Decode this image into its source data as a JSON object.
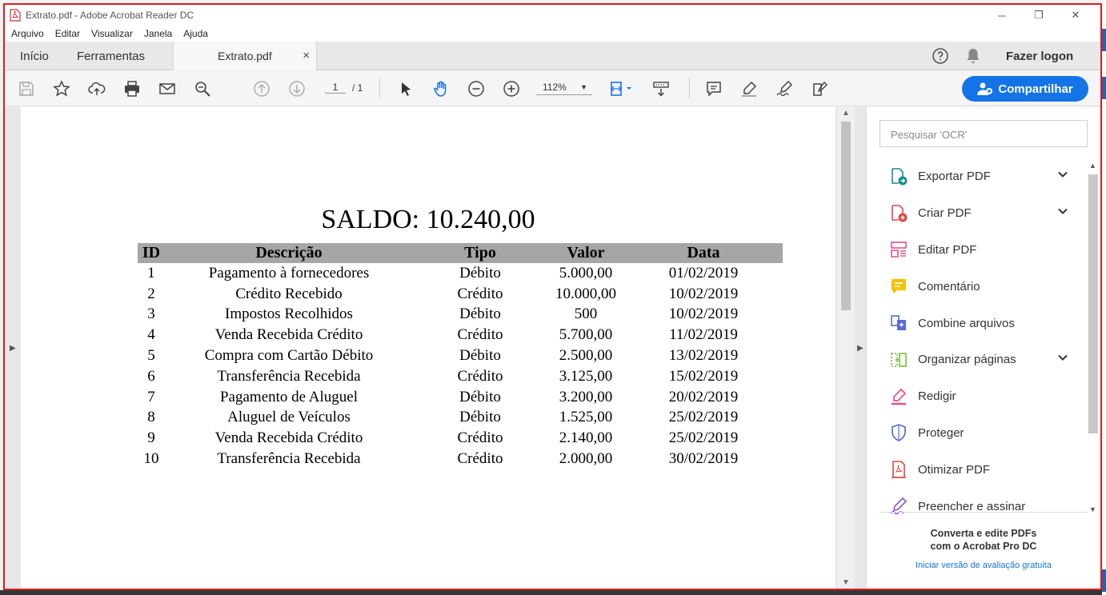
{
  "window": {
    "title": "Extrato.pdf - Adobe Acrobat Reader DC",
    "minimize": "─",
    "restore": "❐",
    "close": "✕"
  },
  "menu": [
    "Arquivo",
    "Editar",
    "Visualizar",
    "Janela",
    "Ajuda"
  ],
  "tabs": {
    "home": "Início",
    "tools": "Ferramentas",
    "document": "Extrato.pdf",
    "close": "×",
    "login": "Fazer logon"
  },
  "toolbar": {
    "page_current": "1",
    "page_total": "/ 1",
    "zoom": "112%",
    "share": "Compartilhar"
  },
  "document": {
    "balance": "SALDO: 10.240,00",
    "columns": [
      "ID",
      "Descrição",
      "Tipo",
      "Valor",
      "Data"
    ],
    "rows": [
      [
        "1",
        "Pagamento à fornecedores",
        "Débito",
        "5.000,00",
        "01/02/2019"
      ],
      [
        "2",
        "Crédito Recebido",
        "Crédito",
        "10.000,00",
        "10/02/2019"
      ],
      [
        "3",
        "Impostos Recolhidos",
        "Débito",
        "500",
        "10/02/2019"
      ],
      [
        "4",
        "Venda Recebida Crédito",
        "Crédito",
        "5.700,00",
        "11/02/2019"
      ],
      [
        "5",
        "Compra com Cartão Débito",
        "Débito",
        "2.500,00",
        "13/02/2019"
      ],
      [
        "6",
        "Transferência Recebida",
        "Crédito",
        "3.125,00",
        "15/02/2019"
      ],
      [
        "7",
        "Pagamento de Aluguel",
        "Débito",
        "3.200,00",
        "20/02/2019"
      ],
      [
        "8",
        "Aluguel de Veículos",
        "Débito",
        "1.525,00",
        "25/02/2019"
      ],
      [
        "9",
        "Venda Recebida Crédito",
        "Crédito",
        "2.140,00",
        "25/02/2019"
      ],
      [
        "10",
        "Transferência Recebida",
        "Crédito",
        "2.000,00",
        "30/02/2019"
      ]
    ]
  },
  "right_panel": {
    "search_placeholder": "Pesquisar 'OCR'",
    "tools": [
      {
        "label": "Exportar PDF",
        "icon": "export-pdf-icon",
        "expandable": true
      },
      {
        "label": "Criar PDF",
        "icon": "create-pdf-icon",
        "expandable": true
      },
      {
        "label": "Editar PDF",
        "icon": "edit-pdf-icon",
        "expandable": false
      },
      {
        "label": "Comentário",
        "icon": "comment-icon",
        "expandable": false
      },
      {
        "label": "Combine arquivos",
        "icon": "combine-files-icon",
        "expandable": false
      },
      {
        "label": "Organizar páginas",
        "icon": "organize-pages-icon",
        "expandable": true
      },
      {
        "label": "Redigir",
        "icon": "redact-icon",
        "expandable": false
      },
      {
        "label": "Proteger",
        "icon": "protect-icon",
        "expandable": false
      },
      {
        "label": "Otimizar PDF",
        "icon": "optimize-pdf-icon",
        "expandable": false
      },
      {
        "label": "Preencher e assinar",
        "icon": "fill-sign-icon",
        "expandable": false
      }
    ],
    "promo_line1": "Converta e edite PDFs",
    "promo_line2": "com o Acrobat Pro DC",
    "promo_link": "Iniciar versão de avaliação gratuita"
  },
  "colors": {
    "accent": "#1473e6",
    "frame_highlight": "#e01b1b",
    "table_header": "#a6a6a6"
  }
}
